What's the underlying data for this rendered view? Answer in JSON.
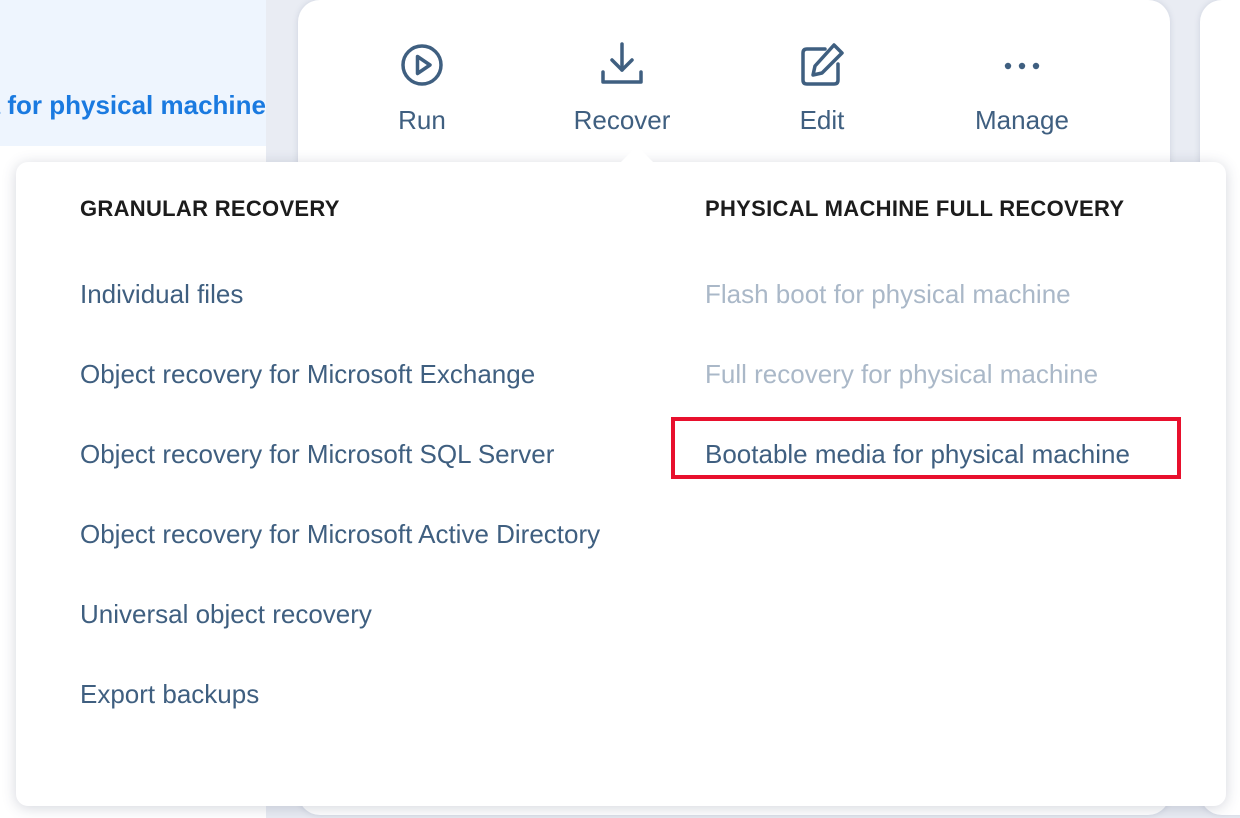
{
  "left_panel": {
    "selected_item_label": "Bootable media for physical machine"
  },
  "toolbar": {
    "run_label": "Run",
    "recover_label": "Recover",
    "edit_label": "Edit",
    "manage_label": "Manage",
    "icons": {
      "run": "play-circle-icon",
      "recover": "download-icon",
      "edit": "edit-icon",
      "manage": "more-horizontal-icon"
    }
  },
  "recover_menu": {
    "granular_heading": "GRANULAR RECOVERY",
    "granular_items": [
      "Individual files",
      "Object recovery for Microsoft Exchange",
      "Object recovery for Microsoft SQL Server",
      "Object recovery for Microsoft Active Directory",
      "Universal object recovery",
      "Export backups"
    ],
    "physical_heading": "PHYSICAL MACHINE FULL RECOVERY",
    "physical_items": [
      "Flash boot for physical machine",
      "Full recovery for physical machine",
      "Bootable media for physical machine"
    ]
  },
  "colors": {
    "accent_link": "#1a7ae0",
    "menu_text": "#3f5f80",
    "disabled_text": "#aab8c8",
    "highlight": "#e8102d"
  }
}
